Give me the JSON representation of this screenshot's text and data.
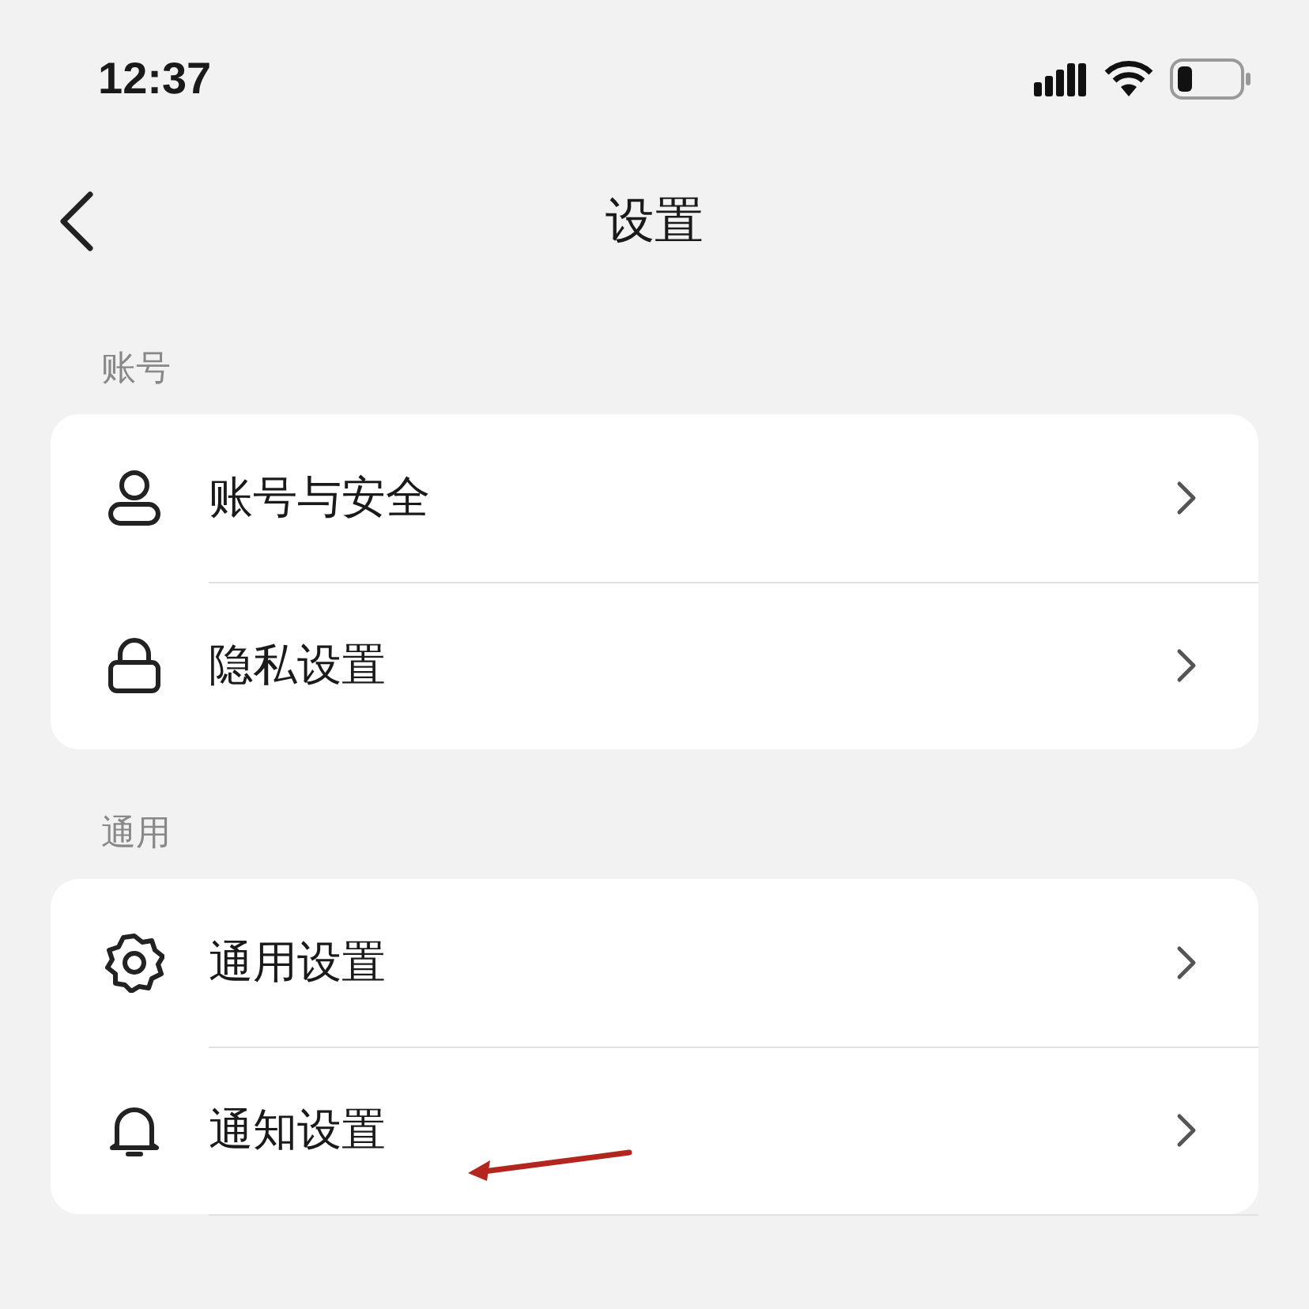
{
  "status_bar": {
    "time": "12:37"
  },
  "nav": {
    "title": "设置"
  },
  "sections": [
    {
      "label": "账号",
      "items": [
        {
          "label": "账号与安全",
          "kind": "person"
        },
        {
          "label": "隐私设置",
          "kind": "lock"
        }
      ]
    },
    {
      "label": "通用",
      "items": [
        {
          "label": "通用设置",
          "kind": "gear"
        },
        {
          "label": "通知设置",
          "kind": "bell"
        }
      ]
    }
  ]
}
